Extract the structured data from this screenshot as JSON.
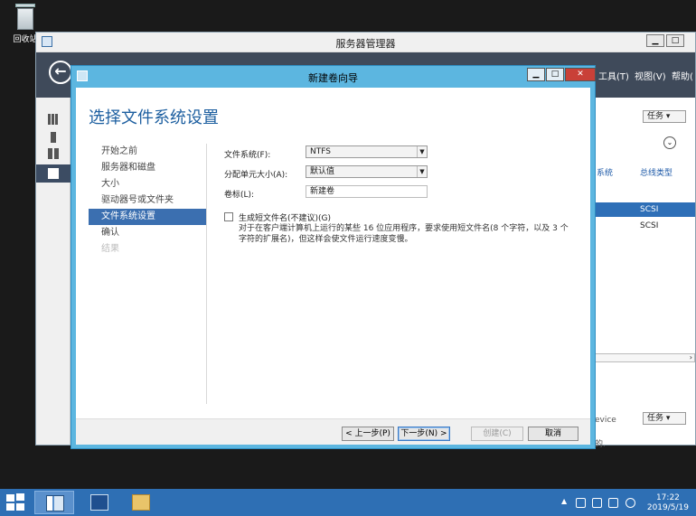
{
  "desktop": {
    "recycle_bin_label": "回收站"
  },
  "server_manager": {
    "title": "服务器管理器",
    "menu": {
      "tools": "工具(T)",
      "view": "视图(V)",
      "help": "帮助("
    },
    "right_panel": {
      "tasks_label": "任务",
      "col_bus": "系统",
      "col_bus_type": "总线类型",
      "rows": [
        "SCSI",
        "SCSI"
      ],
      "device_fragment": "evice",
      "tasks_label_2": "任务",
      "bottom_fragment": "的."
    },
    "window_buttons": {
      "minimize": "▁",
      "maximize": "□"
    }
  },
  "wizard": {
    "title": "新建卷向导",
    "heading": "选择文件系统设置",
    "window_buttons": {
      "minimize": "▁",
      "maximize": "□",
      "close": "✕"
    },
    "nav": [
      {
        "label": "开始之前",
        "state": "normal"
      },
      {
        "label": "服务器和磁盘",
        "state": "normal"
      },
      {
        "label": "大小",
        "state": "normal"
      },
      {
        "label": "驱动器号或文件夹",
        "state": "normal"
      },
      {
        "label": "文件系统设置",
        "state": "selected"
      },
      {
        "label": "确认",
        "state": "normal"
      },
      {
        "label": "结果",
        "state": "disabled"
      }
    ],
    "form": {
      "fs_label": "文件系统(F):",
      "fs_value": "NTFS",
      "alloc_label": "分配单元大小(A):",
      "alloc_value": "默认值",
      "volume_label": "卷标(L):",
      "volume_value": "新建卷",
      "shortname_label": "生成短文件名(不建议)(G)",
      "shortname_desc": "对于在客户端计算机上运行的某些 16 位应用程序，要求使用短文件名(8 个字符，以及 3 个字符的扩展名)，但这样会使文件运行速度变慢。"
    },
    "buttons": {
      "prev": "< 上一步(P)",
      "next": "下一步(N) >",
      "create": "创建(C)",
      "cancel": "取消"
    }
  },
  "taskbar": {
    "time": "17:22",
    "date": "2019/5/19"
  },
  "colors": {
    "wizard_frame": "#5cb6e0",
    "nav_selected": "#3b6fb0",
    "heading": "#1d5fa0",
    "taskbar": "#2e6fb4"
  }
}
